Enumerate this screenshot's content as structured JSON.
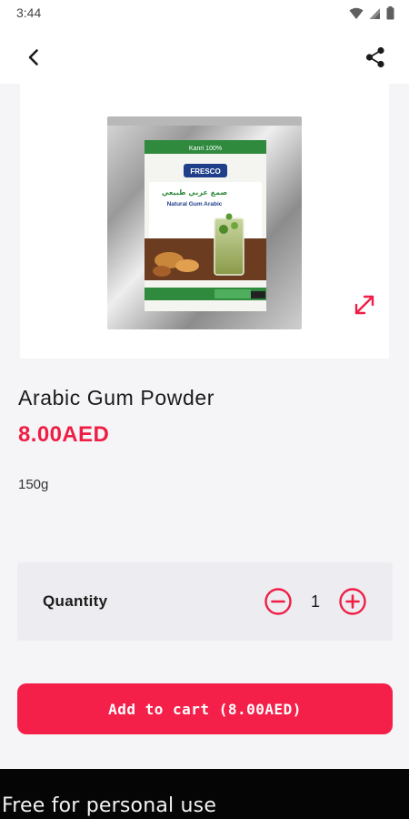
{
  "status_bar": {
    "time": "3:44",
    "icons": [
      "wifi-icon",
      "signal-icon",
      "battery-icon"
    ]
  },
  "app_bar": {
    "back_icon": "back-arrow-icon",
    "share_icon": "share-icon"
  },
  "product": {
    "name": "Arabic Gum Powder",
    "price": "8.00AED",
    "weight": "150g",
    "image_icon": "product-package-image",
    "package_texts": {
      "brand": "FRESCO",
      "arabic_title": "صمغ عربي طبيعي",
      "english_title": "Natural Gum Arabic",
      "top_strip": "Kanri 100%"
    },
    "expand_icon": "expand-icon"
  },
  "quantity": {
    "label": "Quantity",
    "value": "1",
    "minus_icon": "minus-circle-icon",
    "plus_icon": "plus-circle-icon"
  },
  "cart": {
    "button_label": "Add to cart (8.00AED)"
  },
  "banner": {
    "text": "Free for personal use"
  },
  "colors": {
    "accent": "#f4204a",
    "price": "#ef1e45",
    "background": "#f5f5f7",
    "quantity_card": "#ededf1",
    "banner": "#050505"
  }
}
